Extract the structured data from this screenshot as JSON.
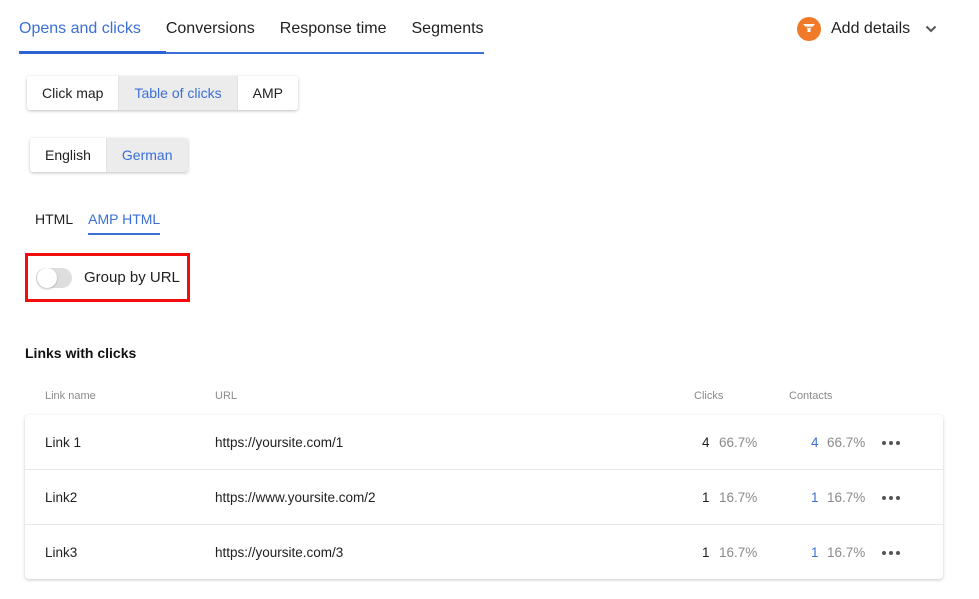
{
  "top_tabs": [
    {
      "label": "Opens and clicks",
      "active": true
    },
    {
      "label": "Conversions",
      "active": false
    },
    {
      "label": "Response time",
      "active": false
    },
    {
      "label": "Segments",
      "active": false
    }
  ],
  "add_details": {
    "label": "Add details",
    "icon": "funnel-icon",
    "icon_color": "#f07a28"
  },
  "view_switch": [
    {
      "label": "Click map",
      "active": false
    },
    {
      "label": "Table of clicks",
      "active": true
    },
    {
      "label": "AMP",
      "active": false
    }
  ],
  "language_switch": [
    {
      "label": "English",
      "active": false
    },
    {
      "label": "German",
      "active": true
    }
  ],
  "format_tabs": [
    {
      "label": "HTML",
      "active": false
    },
    {
      "label": "AMP HTML",
      "active": true
    }
  ],
  "group_by_url": {
    "label": "Group by URL",
    "enabled": false
  },
  "links_section": {
    "title": "Links with clicks",
    "columns": [
      "Link name",
      "URL",
      "Clicks",
      "Contacts"
    ],
    "rows": [
      {
        "name": "Link 1",
        "url": "https://yoursite.com/1",
        "clicks": "4",
        "clicks_pct": "66.7%",
        "contacts": "4",
        "contacts_pct": "66.7%"
      },
      {
        "name": "Link2",
        "url": "https://www.yoursite.com/2",
        "clicks": "1",
        "clicks_pct": "16.7%",
        "contacts": "1",
        "contacts_pct": "16.7%"
      },
      {
        "name": "Link3",
        "url": "https://yoursite.com/3",
        "clicks": "1",
        "clicks_pct": "16.7%",
        "contacts": "1",
        "contacts_pct": "16.7%"
      }
    ]
  },
  "colors": {
    "accent": "#3a6fd8",
    "highlight": "#f20d0d",
    "orange": "#f07a28"
  }
}
